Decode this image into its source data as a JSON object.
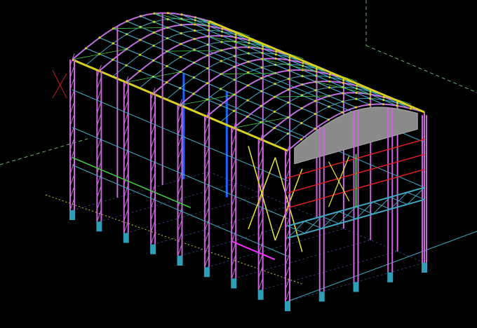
{
  "viewport": {
    "background": "#000000",
    "colors": {
      "column": "#cc66dd",
      "rafter": "#c070e0",
      "purlin": "#3fa7c0",
      "eave": "#d8d020",
      "bracing": "#e8e830",
      "girt_gable": "#e02020",
      "girt": "#40b0c8",
      "green": "#40d040",
      "axis": "#70b070",
      "footing": "#2f9fb8",
      "panel": "#8a8a8a",
      "blue": "#2060ff",
      "grid_ground": "#2a3a6a",
      "ground_line": "#d8d020"
    }
  }
}
